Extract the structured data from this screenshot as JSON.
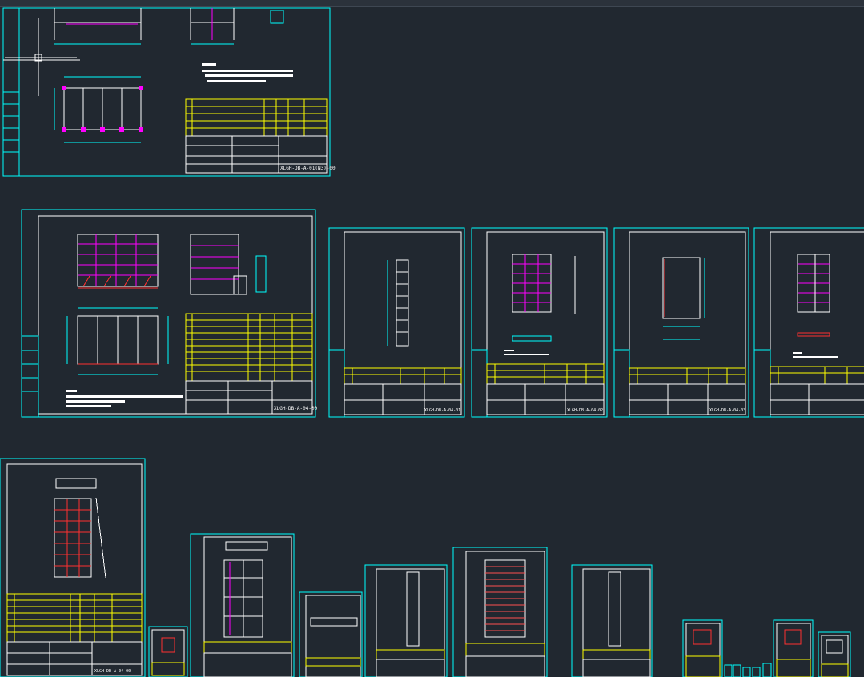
{
  "colors": {
    "background": "#212830",
    "frame": "#00ffff",
    "table": "#ffff00",
    "accent_magenta": "#ff00ff",
    "accent_red": "#ff3030",
    "text_white": "#ffffff",
    "hatch": "#ff5050"
  },
  "drawing_codes": {
    "sheet_main_top": "XLGH-DB-A-01(N3)-00",
    "sheet_main_mid": "XLGH-DB-A-04-00",
    "sheet_small_1": "XLGH-DB-A-04-01",
    "sheet_small_2": "XLGH-DB-A-04-02",
    "sheet_small_3": "XLGH-DB-A-04-03",
    "sheet_bottom_left": "XLGH-DB-A-04-00"
  },
  "cursor": {
    "icon": "crosshair-icon"
  }
}
